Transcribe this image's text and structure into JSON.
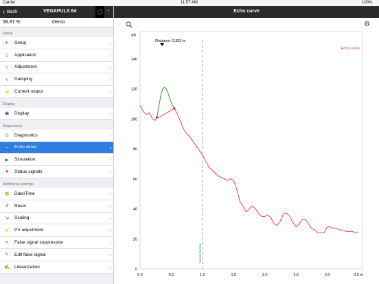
{
  "statusbar": {
    "carrier": "Carrier",
    "time": "11:57 AM",
    "battery": "100%"
  },
  "sidebar": {
    "back_label": "Back",
    "device_name": "VEGAPULS 64",
    "level_value": "58.87 %",
    "mode": "Demo",
    "sections": [
      {
        "title": "Setup",
        "items": [
          {
            "label": "Setup",
            "icon": "setup-icon"
          },
          {
            "label": "Application",
            "icon": "application-icon"
          },
          {
            "label": "Adjustment",
            "icon": "adjustment-icon"
          },
          {
            "label": "Damping",
            "icon": "damping-icon"
          },
          {
            "label": "Current output",
            "icon": "current-output-icon"
          }
        ]
      },
      {
        "title": "Display",
        "items": [
          {
            "label": "Display",
            "icon": "display-icon"
          }
        ]
      },
      {
        "title": "Diagnostics",
        "items": [
          {
            "label": "Diagnostics",
            "icon": "stethoscope-icon"
          },
          {
            "label": "Echo curve",
            "icon": "echo-curve-icon",
            "selected": true
          },
          {
            "label": "Simulation",
            "icon": "simulation-icon"
          },
          {
            "label": "Status signals",
            "icon": "heart-icon"
          }
        ]
      },
      {
        "title": "Additional settings",
        "items": [
          {
            "label": "Date/Time",
            "icon": "calendar-icon"
          },
          {
            "label": "Reset",
            "icon": "reset-icon"
          },
          {
            "label": "Scaling",
            "icon": "scaling-icon"
          },
          {
            "label": "PV adjustment",
            "icon": "pv-adjustment-icon"
          },
          {
            "label": "False signal suppression",
            "icon": "false-signal-icon"
          },
          {
            "label": "Edit false signal",
            "icon": "edit-false-signal-icon"
          },
          {
            "label": "Linearization",
            "icon": "linearization-icon"
          }
        ]
      }
    ]
  },
  "main": {
    "title": "Echo curve"
  },
  "chart_data": {
    "type": "line",
    "ylabel": "dB",
    "legend": "Echo curve",
    "legend_position": "top-right",
    "distance_label": "Distance: 0.353 m",
    "marker_distance": 0.353,
    "vessel_bottom_label": "Vessel bottom",
    "vessel_bottom_x": 1.0,
    "xlim": [
      0,
      3.5
    ],
    "ylim": [
      0,
      150
    ],
    "xticks": [
      "0.0",
      "0.5",
      "1.0",
      "1.5",
      "2.0",
      "2.5",
      "3.0",
      "3.5 m"
    ],
    "yticks": [
      "0",
      "20",
      "40",
      "60",
      "80",
      "100",
      "120",
      "140"
    ],
    "grid": false,
    "colors": {
      "echo": "#ff2a2a",
      "peak": "#2e9b2e",
      "vessel_bottom": "#999999"
    },
    "series": [
      {
        "name": "Echo curve",
        "x": [
          0.0,
          0.05,
          0.1,
          0.15,
          0.2,
          0.24,
          0.27,
          0.3,
          0.55,
          0.6,
          0.65,
          0.7,
          0.75,
          0.8,
          0.85,
          0.9,
          0.95,
          1.0,
          1.05,
          1.1,
          1.15,
          1.2,
          1.25,
          1.3,
          1.35,
          1.4,
          1.45,
          1.5,
          1.55,
          1.6,
          1.65,
          1.7,
          1.75,
          1.8,
          1.85,
          1.9,
          1.95,
          2.0,
          2.05,
          2.1,
          2.15,
          2.2,
          2.25,
          2.3,
          2.35,
          2.4,
          2.45,
          2.5,
          2.55,
          2.6,
          2.65,
          2.7,
          2.75,
          2.8,
          2.85,
          2.9,
          2.95,
          3.0,
          3.05,
          3.1,
          3.15,
          3.2,
          3.25,
          3.3,
          3.35,
          3.4,
          3.45,
          3.5
        ],
        "y": [
          109,
          105,
          103,
          104,
          100,
          99,
          101,
          101,
          107,
          103,
          98,
          93,
          90,
          88,
          85,
          82,
          79,
          76,
          72,
          68,
          66,
          64,
          62,
          61,
          60,
          59,
          60,
          59,
          53,
          45,
          42,
          38,
          40,
          42,
          40,
          37,
          35,
          35,
          36,
          34,
          30,
          29,
          32,
          37,
          37,
          35,
          31,
          28,
          30,
          33,
          33,
          30,
          27,
          26,
          24,
          24,
          24,
          28,
          28,
          27,
          27,
          26,
          26,
          25,
          25,
          25,
          24,
          24
        ]
      },
      {
        "name": "Peak",
        "x": [
          0.27,
          0.3,
          0.33,
          0.36,
          0.39,
          0.42,
          0.45,
          0.48,
          0.52,
          0.55
        ],
        "y": [
          101,
          108,
          115,
          120,
          121,
          120,
          117,
          113,
          109,
          107
        ]
      }
    ]
  }
}
